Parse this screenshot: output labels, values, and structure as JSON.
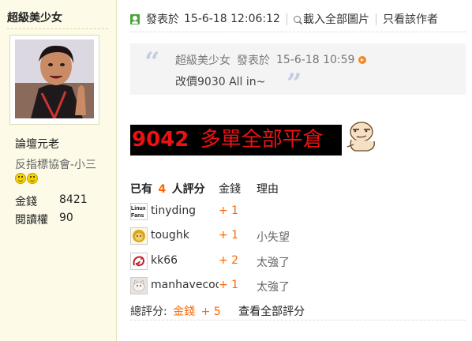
{
  "sidebar": {
    "username": "超級美少女",
    "rank": "論壇元老",
    "group": "反指標協會-小三",
    "stats": [
      {
        "label": "金錢",
        "value": "8421"
      },
      {
        "label": "閱讀權",
        "value": "90"
      }
    ]
  },
  "post_header": {
    "posted_prefix": "發表於",
    "posted_time": "15-6-18 12:06:12",
    "load_images": "載入全部圖片",
    "author_only": "只看該作者"
  },
  "quote": {
    "author": "超級美少女",
    "posted_prefix": "發表於",
    "time": "15-6-18 10:59",
    "text": "改價9030 All in~"
  },
  "headline": {
    "number": "9042",
    "text": "多單全部平倉"
  },
  "rating": {
    "prefix": "已有",
    "count": "4",
    "suffix": "人評分",
    "col_money": "金錢",
    "col_reason": "理由",
    "rows": [
      {
        "name": "tinyding",
        "score": "+ 1",
        "reason": ""
      },
      {
        "name": "toughk",
        "score": "+ 1",
        "reason": "小失望"
      },
      {
        "name": "kk66",
        "score": "+ 2",
        "reason": "太強了"
      },
      {
        "name": "manhavecoo",
        "score": "+ 1",
        "reason": "太強了"
      }
    ],
    "total_label": "總評分:",
    "total_currency": "金錢",
    "total_value": "+ 5",
    "view_all": "查看全部評分"
  },
  "colors": {
    "accent_orange": "#ff6600",
    "headline_red": "#ee1111",
    "sidebar_bg": "#fdfbe8"
  }
}
